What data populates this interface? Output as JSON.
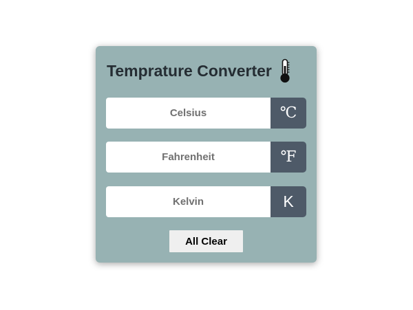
{
  "app": {
    "title": "Temprature Converter",
    "title_icon": "thermometer-icon"
  },
  "fields": [
    {
      "placeholder": "Celsius",
      "value": "",
      "unit": "℃"
    },
    {
      "placeholder": "Fahrenheit",
      "value": "",
      "unit": "℉"
    },
    {
      "placeholder": "Kelvin",
      "value": "",
      "unit": "K"
    }
  ],
  "actions": {
    "clear_label": "All Clear"
  },
  "colors": {
    "card_bg": "#97b2b3",
    "unit_bg": "#4e5a68",
    "title_text": "#252d33",
    "button_bg": "#efefef"
  }
}
